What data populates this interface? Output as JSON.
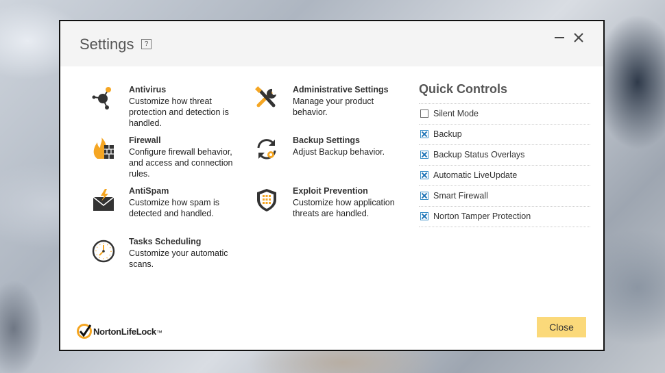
{
  "window": {
    "title": "Settings",
    "help_label": "?",
    "minimize_icon": "minimize-icon",
    "close_icon": "close-icon"
  },
  "settings_items": [
    {
      "name": "Antivirus",
      "desc": "Customize how threat protection and detection is handled.",
      "icon": "molecule-icon"
    },
    {
      "name": "Firewall",
      "desc": "Configure firewall behavior, and access and connection rules.",
      "icon": "flame-brick-icon"
    },
    {
      "name": "AntiSpam",
      "desc": "Customize how spam is detected and handled.",
      "icon": "envelope-bolt-icon"
    },
    {
      "name": "Tasks Scheduling",
      "desc": "Customize your automatic scans.",
      "icon": "clock-icon"
    },
    {
      "name": "Administrative Settings",
      "desc": "Manage your product behavior.",
      "icon": "tools-icon"
    },
    {
      "name": "Backup Settings",
      "desc": "Adjust Backup behavior.",
      "icon": "backup-sync-icon"
    },
    {
      "name": "Exploit Prevention",
      "desc": "Customize how application threats are handled.",
      "icon": "shield-icon"
    }
  ],
  "quick_controls": {
    "title": "Quick Controls",
    "items": [
      {
        "label": "Silent Mode",
        "checked": false
      },
      {
        "label": "Backup",
        "checked": true
      },
      {
        "label": "Backup Status Overlays",
        "checked": true
      },
      {
        "label": "Automatic LiveUpdate",
        "checked": true
      },
      {
        "label": "Smart Firewall",
        "checked": true
      },
      {
        "label": "Norton Tamper Protection",
        "checked": true
      }
    ]
  },
  "footer": {
    "logo_part1": "Norton",
    "logo_part2": "LifeLock",
    "trademark": "™",
    "close_label": "Close"
  },
  "colors": {
    "accent_yellow": "#fbd97a",
    "icon_orange": "#f5a623",
    "icon_dark": "#333333",
    "checkbox_blue": "#1f74b6"
  }
}
